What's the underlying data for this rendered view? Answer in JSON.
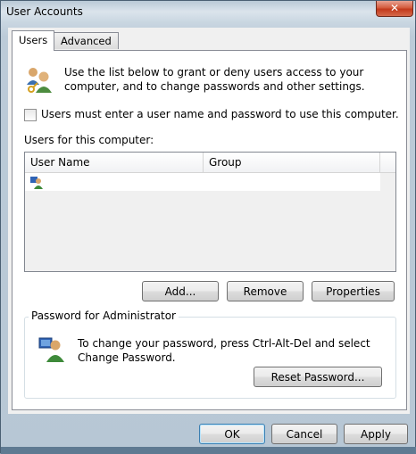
{
  "window": {
    "title": "User Accounts",
    "close_glyph": "✕"
  },
  "tabs": [
    {
      "label": "Users"
    },
    {
      "label": "Advanced"
    }
  ],
  "intro": {
    "text": "Use the list below to grant or deny users access to your computer, and to change passwords and other settings."
  },
  "require_login": {
    "label": "Users must enter a user name and password to use this computer.",
    "checked": false
  },
  "users_list": {
    "label": "Users for this computer:",
    "columns": [
      "User Name",
      "Group"
    ],
    "rows": [
      {
        "user_name": "",
        "group": "",
        "icon": "user-icon"
      }
    ]
  },
  "list_buttons": {
    "add": "Add...",
    "remove": "Remove",
    "properties": "Properties"
  },
  "password_group": {
    "title": "Password for Administrator",
    "text": "To change your password, press Ctrl-Alt-Del and select Change Password.",
    "reset_label": "Reset Password...",
    "icon": "admin-user-icon"
  },
  "dialog_buttons": {
    "ok": "OK",
    "cancel": "Cancel",
    "apply": "Apply"
  },
  "colors": {
    "accent": "#3c7fb1",
    "close": "#c2391c",
    "panel": "#ffffff"
  }
}
